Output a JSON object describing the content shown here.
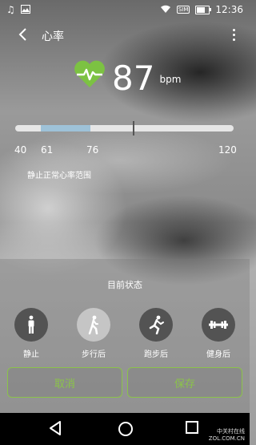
{
  "status_bar": {
    "time": "12:36",
    "sim_label": "SIM",
    "left_icons": [
      "music-note-icon",
      "image-icon"
    ],
    "right_icons": [
      "wifi-icon",
      "sim-icon",
      "battery-icon"
    ]
  },
  "app_bar": {
    "title": "心率"
  },
  "heart_rate": {
    "value": "87",
    "unit": "bpm",
    "icon": "heart-pulse-icon",
    "icon_color": "#7cc242"
  },
  "range": {
    "min": 40,
    "max": 120,
    "low": 61,
    "high": 76,
    "current": 87,
    "ticks": [
      "40",
      "61",
      "76",
      "120"
    ],
    "label": "静止正常心率范围",
    "fill_color": "#9ec2d8"
  },
  "state": {
    "title": "目前状态",
    "options": [
      {
        "label": "静止",
        "icon": "standing-person-icon",
        "selected": false
      },
      {
        "label": "步行后",
        "icon": "walking-person-icon",
        "selected": true
      },
      {
        "label": "跑步后",
        "icon": "running-person-icon",
        "selected": false
      },
      {
        "label": "健身后",
        "icon": "dumbbell-icon",
        "selected": false
      }
    ]
  },
  "actions": {
    "cancel": "取消",
    "save": "保存",
    "accent": "#8bc34a"
  },
  "watermark": {
    "line1": "中关村在线",
    "line2": "ZOL.COM.CN"
  }
}
